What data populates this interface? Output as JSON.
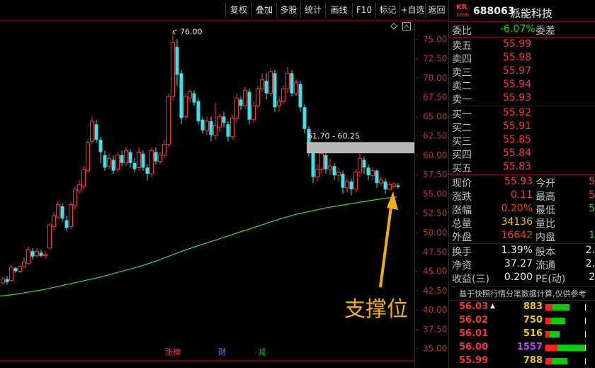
{
  "toolbar": {
    "buttons": [
      "复权",
      "叠加",
      "多股",
      "统计",
      "画线",
      "F10",
      "标记",
      "+自选",
      "返回"
    ]
  },
  "header": {
    "exchange_badge": "KR",
    "badge_sub": "1000",
    "code": "688063",
    "name": "派能科技"
  },
  "order_book": {
    "ratio_label": "委比",
    "ratio_value": "-6.07%",
    "diff_label": "委差",
    "asks": [
      {
        "label": "卖五",
        "price": "55.99"
      },
      {
        "label": "卖四",
        "price": "55.98"
      },
      {
        "label": "卖三",
        "price": "55.97"
      },
      {
        "label": "卖二",
        "price": "55.94"
      },
      {
        "label": "卖一",
        "price": "55.93"
      }
    ],
    "bids": [
      {
        "label": "买一",
        "price": "55.92"
      },
      {
        "label": "买二",
        "price": "55.91"
      },
      {
        "label": "买三",
        "price": "55.85"
      },
      {
        "label": "买四",
        "price": "55.84"
      },
      {
        "label": "买五",
        "price": "55.83"
      }
    ]
  },
  "quote": [
    {
      "l1": "现价",
      "v1": "55.93",
      "c1": "red",
      "l2": "今开",
      "v2": "5",
      "c2": "red"
    },
    {
      "l1": "涨跌",
      "v1": "0.11",
      "c1": "red",
      "l2": "最高",
      "v2": "5",
      "c2": "red"
    },
    {
      "l1": "涨幅",
      "v1": "0.20%",
      "c1": "red",
      "l2": "最低",
      "v2": "5",
      "c2": "green"
    },
    {
      "l1": "总量",
      "v1": "34136",
      "c1": "yellow",
      "l2": "量比",
      "v2": "",
      "c2": "white"
    },
    {
      "l1": "外盘",
      "v1": "16642",
      "c1": "red",
      "l2": "内盘",
      "v2": "1",
      "c2": "green"
    }
  ],
  "stats": [
    {
      "l1": "换手",
      "v1": "1.39%",
      "l2": "股本",
      "v2": "2."
    },
    {
      "l1": "净资",
      "v1": "37.27",
      "l2": "流通",
      "v2": "2."
    },
    {
      "l1": "收益(三)",
      "v1": "0.200",
      "l2": "PE(动)",
      "v2": "2"
    }
  ],
  "ticks_note": "基于快照行情分笔数据计算,仅供参考",
  "ticks": [
    {
      "price": "56.03",
      "arrow": "▲",
      "vol": "883",
      "vcolor": "yellow",
      "bar": 0.6
    },
    {
      "price": "56.02",
      "arrow": "",
      "vol": "750",
      "vcolor": "yellow",
      "bar": 0.5
    },
    {
      "price": "56.01",
      "arrow": "",
      "vol": "516",
      "vcolor": "yellow",
      "bar": 0.35
    },
    {
      "price": "56.00",
      "arrow": "",
      "vol": "1557",
      "vcolor": "purple",
      "bar": 1.0
    },
    {
      "price": "55.99",
      "arrow": "",
      "vol": "788",
      "vcolor": "yellow",
      "bar": 0.55
    }
  ],
  "chart_data": {
    "type": "candlestick",
    "y_ticks": [
      "75.00",
      "72.50",
      "70.00",
      "67.50",
      "65.00",
      "62.50",
      "60.00",
      "57.50",
      "55.00",
      "52.50",
      "50.00",
      "47.50",
      "45.00",
      "42.50",
      "40.00",
      "37.50",
      "35.00"
    ],
    "y_range": [
      33.5,
      77.5
    ],
    "high_label": "76.00",
    "zone": {
      "label": "61.70 - 60.25",
      "top": 61.7,
      "bottom": 60.25
    },
    "annotation": "支撑位",
    "bottom_marks": [
      {
        "text": "涨榜",
        "color": "#ff3232"
      },
      {
        "text": "财",
        "color": "#4a8cff"
      },
      {
        "text": "减",
        "color": "#00c000"
      }
    ],
    "ma_line": [
      [
        0,
        41.8
      ],
      [
        20,
        42.0
      ],
      [
        40,
        42.3
      ],
      [
        60,
        42.6
      ],
      [
        80,
        43.0
      ],
      [
        100,
        43.4
      ],
      [
        120,
        43.8
      ],
      [
        140,
        44.2
      ],
      [
        160,
        44.7
      ],
      [
        180,
        45.2
      ],
      [
        200,
        45.7
      ],
      [
        220,
        46.3
      ],
      [
        240,
        47.0
      ],
      [
        260,
        47.7
      ],
      [
        280,
        48.3
      ],
      [
        300,
        48.9
      ],
      [
        320,
        49.5
      ],
      [
        340,
        50.1
      ],
      [
        360,
        50.7
      ],
      [
        380,
        51.3
      ],
      [
        400,
        51.9
      ],
      [
        420,
        52.4
      ],
      [
        440,
        52.8
      ],
      [
        460,
        53.2
      ],
      [
        480,
        53.5
      ],
      [
        500,
        53.8
      ],
      [
        520,
        54.1
      ],
      [
        540,
        54.4
      ],
      [
        560,
        54.6
      ]
    ],
    "candles": [
      [
        4,
        43.5,
        44.0,
        43.2,
        44.3
      ],
      [
        10,
        44.0,
        43.6,
        43.3,
        44.4
      ],
      [
        16,
        43.8,
        45.5,
        43.6,
        45.8
      ],
      [
        22,
        45.4,
        45.0,
        44.8,
        45.6
      ],
      [
        28,
        45.0,
        45.6,
        44.8,
        45.8
      ],
      [
        34,
        45.6,
        46.2,
        45.4,
        46.8
      ],
      [
        40,
        46.0,
        47.8,
        45.9,
        48.2
      ],
      [
        46,
        47.6,
        46.9,
        46.5,
        48.0
      ],
      [
        52,
        47.0,
        47.6,
        46.8,
        48.0
      ],
      [
        58,
        47.4,
        47.0,
        46.8,
        47.8
      ],
      [
        64,
        47.0,
        47.2,
        46.6,
        47.6
      ],
      [
        70,
        48.0,
        51.0,
        47.8,
        51.3
      ],
      [
        76,
        50.8,
        52.2,
        50.2,
        52.6
      ],
      [
        82,
        52.0,
        53.6,
        51.8,
        54.0
      ],
      [
        88,
        53.4,
        51.8,
        51.4,
        53.8
      ],
      [
        94,
        51.6,
        50.6,
        50.2,
        52.2
      ],
      [
        100,
        50.8,
        53.6,
        50.4,
        54.0
      ],
      [
        106,
        53.5,
        55.6,
        53.0,
        56.0
      ],
      [
        112,
        55.4,
        56.2,
        55.0,
        56.8
      ],
      [
        118,
        56.0,
        58.2,
        55.6,
        58.6
      ],
      [
        124,
        58.0,
        61.6,
        57.8,
        62.0
      ],
      [
        130,
        61.8,
        64.4,
        61.4,
        65.0
      ],
      [
        136,
        64.0,
        62.0,
        61.6,
        64.6
      ],
      [
        142,
        62.0,
        60.4,
        59.0,
        62.4
      ],
      [
        148,
        60.0,
        58.4,
        58.0,
        60.6
      ],
      [
        154,
        58.6,
        59.6,
        58.2,
        60.2
      ],
      [
        160,
        59.4,
        58.0,
        57.6,
        60.0
      ],
      [
        166,
        58.2,
        60.0,
        57.8,
        60.4
      ],
      [
        172,
        60.0,
        59.0,
        58.6,
        60.6
      ],
      [
        178,
        59.0,
        60.6,
        58.6,
        61.0
      ],
      [
        184,
        60.4,
        59.0,
        58.4,
        60.8
      ],
      [
        190,
        59.0,
        58.2,
        57.8,
        59.6
      ],
      [
        196,
        58.4,
        60.4,
        58.0,
        61.0
      ],
      [
        202,
        60.2,
        58.4,
        58.0,
        60.6
      ],
      [
        208,
        58.4,
        57.6,
        56.8,
        58.8
      ],
      [
        214,
        57.6,
        60.6,
        57.2,
        61.0
      ],
      [
        220,
        60.4,
        59.2,
        58.8,
        61.0
      ],
      [
        226,
        59.2,
        60.0,
        58.8,
        60.4
      ],
      [
        232,
        60.0,
        61.4,
        59.6,
        62.0
      ],
      [
        238,
        61.4,
        67.6,
        61.0,
        68.0
      ],
      [
        244,
        67.6,
        74.6,
        67.0,
        76.0
      ],
      [
        250,
        74.0,
        70.4,
        69.0,
        75.0
      ],
      [
        256,
        70.6,
        64.8,
        64.0,
        71.0
      ],
      [
        262,
        65.0,
        67.6,
        64.6,
        68.0
      ],
      [
        268,
        67.4,
        68.2,
        66.8,
        68.6
      ],
      [
        274,
        68.0,
        66.8,
        66.4,
        68.4
      ],
      [
        280,
        67.0,
        64.4,
        64.0,
        67.4
      ],
      [
        286,
        64.6,
        63.2,
        62.8,
        65.0
      ],
      [
        292,
        63.2,
        64.4,
        62.6,
        65.0
      ],
      [
        298,
        64.4,
        62.6,
        61.8,
        65.0
      ],
      [
        304,
        62.6,
        63.8,
        62.0,
        66.8
      ],
      [
        310,
        63.6,
        65.0,
        63.0,
        65.4
      ],
      [
        316,
        65.0,
        64.2,
        63.6,
        65.6
      ],
      [
        322,
        64.0,
        62.4,
        61.8,
        64.4
      ],
      [
        328,
        62.4,
        64.8,
        62.0,
        65.2
      ],
      [
        334,
        64.8,
        67.4,
        64.2,
        68.0
      ],
      [
        340,
        67.2,
        66.4,
        65.8,
        67.6
      ],
      [
        346,
        66.4,
        68.4,
        66.0,
        68.8
      ],
      [
        352,
        68.2,
        64.6,
        64.0,
        68.6
      ],
      [
        358,
        64.6,
        66.4,
        64.2,
        67.0
      ],
      [
        364,
        66.4,
        68.6,
        66.0,
        69.0
      ],
      [
        370,
        68.6,
        69.8,
        68.2,
        70.6
      ],
      [
        376,
        69.6,
        68.0,
        67.2,
        70.6
      ],
      [
        382,
        68.0,
        70.8,
        67.6,
        71.2
      ],
      [
        388,
        70.6,
        66.2,
        65.6,
        71.0
      ],
      [
        394,
        66.4,
        67.0,
        65.6,
        67.6
      ],
      [
        400,
        67.0,
        68.6,
        66.6,
        69.0
      ],
      [
        406,
        68.6,
        70.6,
        68.0,
        71.4
      ],
      [
        412,
        70.6,
        68.0,
        67.6,
        71.0
      ],
      [
        418,
        68.0,
        69.4,
        67.6,
        69.8
      ],
      [
        424,
        69.2,
        66.2,
        65.6,
        69.6
      ],
      [
        430,
        66.2,
        63.4,
        62.8,
        66.6
      ],
      [
        436,
        63.4,
        60.6,
        59.8,
        63.8
      ],
      [
        442,
        60.4,
        57.2,
        56.4,
        60.6
      ],
      [
        448,
        57.2,
        58.2,
        56.6,
        58.8
      ],
      [
        454,
        58.2,
        60.2,
        57.6,
        60.6
      ],
      [
        460,
        60.0,
        58.2,
        57.6,
        60.4
      ],
      [
        466,
        58.2,
        58.6,
        57.4,
        59.6
      ],
      [
        472,
        58.6,
        57.4,
        56.8,
        59.0
      ],
      [
        478,
        57.4,
        57.8,
        56.6,
        58.4
      ],
      [
        484,
        57.6,
        55.8,
        55.0,
        58.0
      ],
      [
        490,
        55.8,
        56.6,
        55.2,
        57.0
      ],
      [
        496,
        56.6,
        55.6,
        54.8,
        57.0
      ],
      [
        502,
        55.6,
        57.8,
        55.2,
        58.2
      ],
      [
        508,
        57.8,
        59.6,
        57.2,
        60.2
      ],
      [
        514,
        59.4,
        58.4,
        57.6,
        59.8
      ],
      [
        520,
        58.4,
        57.4,
        56.8,
        58.8
      ],
      [
        526,
        57.4,
        58.0,
        56.8,
        58.4
      ],
      [
        532,
        58.0,
        56.4,
        55.8,
        58.2
      ],
      [
        538,
        56.4,
        56.8,
        56.0,
        57.2
      ],
      [
        544,
        56.6,
        55.6,
        55.0,
        57.0
      ],
      [
        550,
        55.6,
        56.2,
        55.4,
        56.6
      ],
      [
        556,
        56.0,
        56.3,
        55.8,
        56.5
      ],
      [
        562,
        56.1,
        55.9,
        55.7,
        56.4
      ]
    ]
  }
}
